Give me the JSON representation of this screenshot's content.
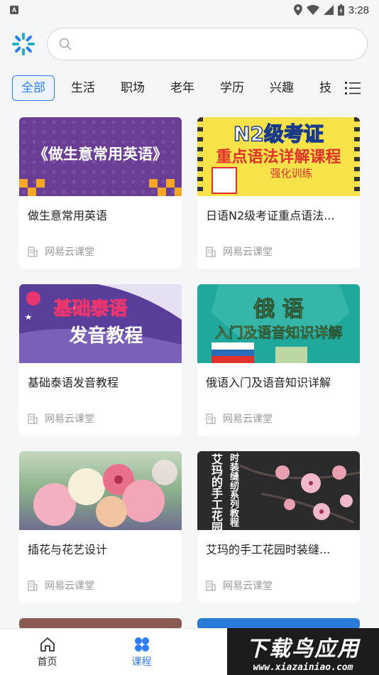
{
  "status_bar": {
    "time": "3:28"
  },
  "search": {
    "placeholder": ""
  },
  "tabs": [
    {
      "label": "全部",
      "active": true
    },
    {
      "label": "生活"
    },
    {
      "label": "职场"
    },
    {
      "label": "老年"
    },
    {
      "label": "学历"
    },
    {
      "label": "兴趣"
    },
    {
      "label": "技"
    }
  ],
  "courses": [
    {
      "title": "做生意常用英语",
      "source": "网易云课堂",
      "thumb_text": "《做生意常用英语》"
    },
    {
      "title": "日语N2级考证重点语法...",
      "source": "网易云课堂",
      "thumb_text_1": "N2级考证",
      "thumb_text_2": "重点语法详解课程",
      "thumb_text_3": "强化训练"
    },
    {
      "title": "基础泰语发音教程",
      "source": "网易云课堂",
      "thumb_text_1": "基础泰语",
      "thumb_text_2": "发音教程"
    },
    {
      "title": "俄语入门及语音知识详解",
      "source": "网易云课堂",
      "thumb_text_1": "俄 语",
      "thumb_text_2": "入门及语音知识详解"
    },
    {
      "title": "插花与花艺设计",
      "source": "网易云课堂"
    },
    {
      "title": "艾玛的手工花园时装缝...",
      "source": "网易云课堂",
      "thumb_text_1": "艾玛的手工花园",
      "thumb_text_2": "时装缝纫系列教程"
    }
  ],
  "bottom_nav": [
    {
      "label": "首页",
      "icon": "home-icon"
    },
    {
      "label": "课程",
      "icon": "courses-icon",
      "active": true
    }
  ],
  "watermark": {
    "main": "下载鸟应用",
    "sub": "www.xiazainiao.com"
  }
}
